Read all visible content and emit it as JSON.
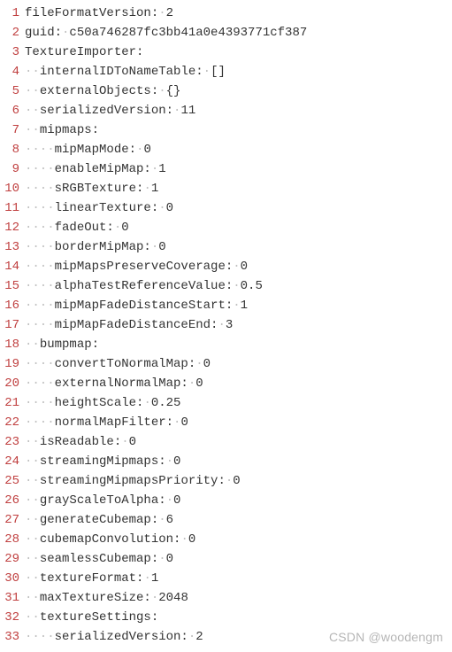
{
  "lines": [
    {
      "n": 1,
      "indent": 0,
      "text": "fileFormatVersion: 2"
    },
    {
      "n": 2,
      "indent": 0,
      "text": "guid: c50a746287fc3bb41a0e4393771cf387"
    },
    {
      "n": 3,
      "indent": 0,
      "text": "TextureImporter:"
    },
    {
      "n": 4,
      "indent": 2,
      "text": "internalIDToNameTable: []"
    },
    {
      "n": 5,
      "indent": 2,
      "text": "externalObjects: {}"
    },
    {
      "n": 6,
      "indent": 2,
      "text": "serializedVersion: 11"
    },
    {
      "n": 7,
      "indent": 2,
      "text": "mipmaps:"
    },
    {
      "n": 8,
      "indent": 4,
      "text": "mipMapMode: 0"
    },
    {
      "n": 9,
      "indent": 4,
      "text": "enableMipMap: 1"
    },
    {
      "n": 10,
      "indent": 4,
      "text": "sRGBTexture: 1"
    },
    {
      "n": 11,
      "indent": 4,
      "text": "linearTexture: 0"
    },
    {
      "n": 12,
      "indent": 4,
      "text": "fadeOut: 0"
    },
    {
      "n": 13,
      "indent": 4,
      "text": "borderMipMap: 0"
    },
    {
      "n": 14,
      "indent": 4,
      "text": "mipMapsPreserveCoverage: 0"
    },
    {
      "n": 15,
      "indent": 4,
      "text": "alphaTestReferenceValue: 0.5"
    },
    {
      "n": 16,
      "indent": 4,
      "text": "mipMapFadeDistanceStart: 1"
    },
    {
      "n": 17,
      "indent": 4,
      "text": "mipMapFadeDistanceEnd: 3"
    },
    {
      "n": 18,
      "indent": 2,
      "text": "bumpmap:"
    },
    {
      "n": 19,
      "indent": 4,
      "text": "convertToNormalMap: 0"
    },
    {
      "n": 20,
      "indent": 4,
      "text": "externalNormalMap: 0"
    },
    {
      "n": 21,
      "indent": 4,
      "text": "heightScale: 0.25"
    },
    {
      "n": 22,
      "indent": 4,
      "text": "normalMapFilter: 0"
    },
    {
      "n": 23,
      "indent": 2,
      "text": "isReadable: 0"
    },
    {
      "n": 24,
      "indent": 2,
      "text": "streamingMipmaps: 0"
    },
    {
      "n": 25,
      "indent": 2,
      "text": "streamingMipmapsPriority: 0"
    },
    {
      "n": 26,
      "indent": 2,
      "text": "grayScaleToAlpha: 0"
    },
    {
      "n": 27,
      "indent": 2,
      "text": "generateCubemap: 6"
    },
    {
      "n": 28,
      "indent": 2,
      "text": "cubemapConvolution: 0"
    },
    {
      "n": 29,
      "indent": 2,
      "text": "seamlessCubemap: 0"
    },
    {
      "n": 30,
      "indent": 2,
      "text": "textureFormat: 1"
    },
    {
      "n": 31,
      "indent": 2,
      "text": "maxTextureSize: 2048"
    },
    {
      "n": 32,
      "indent": 2,
      "text": "textureSettings:"
    },
    {
      "n": 33,
      "indent": 4,
      "text": "serializedVersion: 2"
    }
  ],
  "watermark": "CSDN @woodengm"
}
